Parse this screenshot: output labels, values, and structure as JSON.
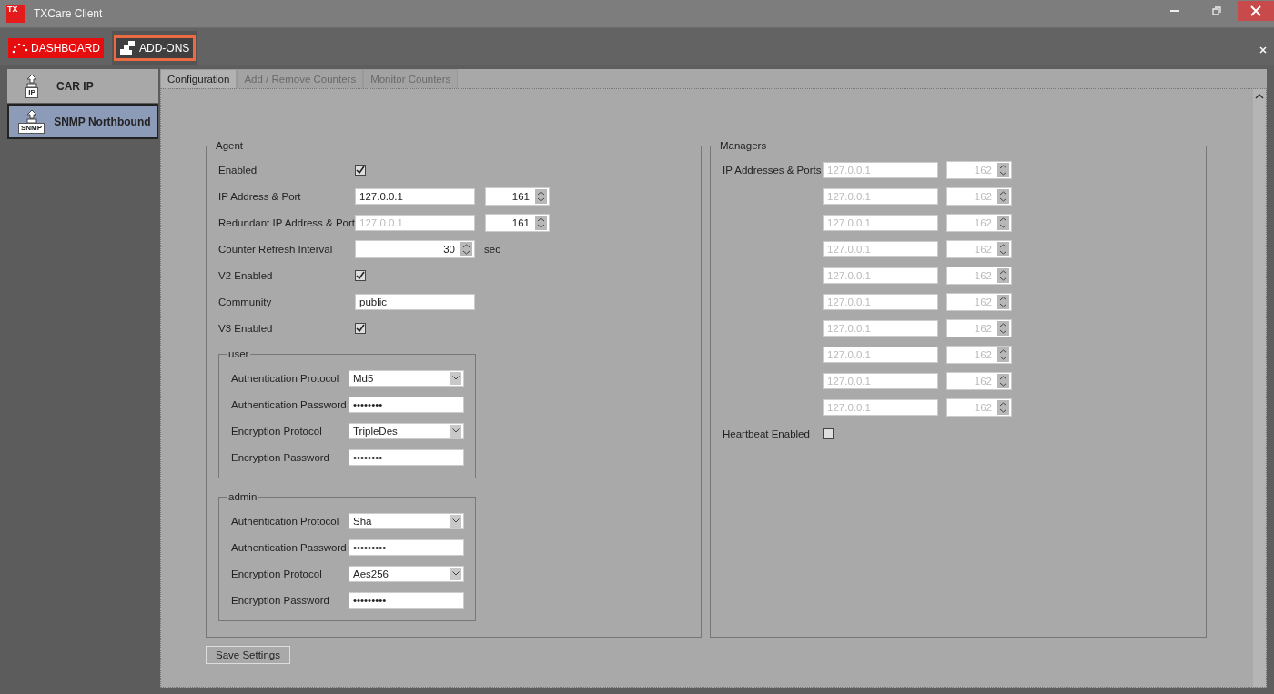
{
  "window": {
    "title": "TXCare Client",
    "app_badge": "TX"
  },
  "top_tabs": [
    {
      "label": "DASHBOARD",
      "kind": "dashboard",
      "selected": false
    },
    {
      "label": "ADD-ONS",
      "kind": "addons",
      "selected": true
    }
  ],
  "sidebar": {
    "items": [
      {
        "label": "CAR IP",
        "badge": "IP",
        "selected": false
      },
      {
        "label": "SNMP Northbound",
        "badge": "SNMP",
        "selected": true
      }
    ]
  },
  "tabs": [
    {
      "label": "Configuration",
      "selected": true,
      "disabled": false
    },
    {
      "label": "Add / Remove Counters",
      "selected": false,
      "disabled": true
    },
    {
      "label": "Monitor Counters",
      "selected": false,
      "disabled": true
    }
  ],
  "agent": {
    "title": "Agent",
    "rows": [
      {
        "kind": "checkbox",
        "label": "Enabled",
        "checked": true
      },
      {
        "kind": "ip_port",
        "label": "IP Address & Port",
        "ip": {
          "value": "127.0.0.1"
        },
        "port": "161"
      },
      {
        "kind": "ip_port",
        "label": "Redundant IP Address & Port",
        "ip": {
          "placeholder": "127.0.0.1"
        },
        "port": "161"
      },
      {
        "kind": "spin",
        "label": "Counter Refresh Interval",
        "value": "30",
        "unit": "sec"
      },
      {
        "kind": "checkbox",
        "label": "V2 Enabled",
        "checked": true
      },
      {
        "kind": "text",
        "label": "Community",
        "value": "public"
      },
      {
        "kind": "checkbox",
        "label": "V3 Enabled",
        "checked": true
      }
    ],
    "groups": [
      {
        "title": "user",
        "rows": [
          {
            "kind": "select",
            "label": "Authentication Protocol",
            "value": "Md5"
          },
          {
            "kind": "password",
            "label": "Authentication Password",
            "value": "••••••••"
          },
          {
            "kind": "select",
            "label": "Encryption Protocol",
            "value": "TripleDes"
          },
          {
            "kind": "password",
            "label": "Encryption Password",
            "value": "••••••••"
          }
        ]
      },
      {
        "title": "admin",
        "rows": [
          {
            "kind": "select",
            "label": "Authentication Protocol",
            "value": "Sha"
          },
          {
            "kind": "password",
            "label": "Authentication Password",
            "value": "•••••••••"
          },
          {
            "kind": "select",
            "label": "Encryption Protocol",
            "value": "Aes256"
          },
          {
            "kind": "password",
            "label": "Encryption Password",
            "value": "•••••••••"
          }
        ]
      }
    ]
  },
  "managers": {
    "title": "Managers",
    "label": "IP Addresses & Ports",
    "entries": [
      {
        "ip_placeholder": "127.0.0.1",
        "port": "162",
        "disabled": true
      },
      {
        "ip_placeholder": "127.0.0.1",
        "port": "162",
        "disabled": true
      },
      {
        "ip_placeholder": "127.0.0.1",
        "port": "162",
        "disabled": true
      },
      {
        "ip_placeholder": "127.0.0.1",
        "port": "162",
        "disabled": true
      },
      {
        "ip_placeholder": "127.0.0.1",
        "port": "162",
        "disabled": true
      },
      {
        "ip_placeholder": "127.0.0.1",
        "port": "162",
        "disabled": true
      },
      {
        "ip_placeholder": "127.0.0.1",
        "port": "162",
        "disabled": true
      },
      {
        "ip_placeholder": "127.0.0.1",
        "port": "162",
        "disabled": true
      },
      {
        "ip_placeholder": "127.0.0.1",
        "port": "162",
        "disabled": true
      },
      {
        "ip_placeholder": "127.0.0.1",
        "port": "162",
        "disabled": true
      }
    ],
    "heartbeat": {
      "label": "Heartbeat Enabled",
      "checked": false
    }
  },
  "save_button": "Save Settings"
}
